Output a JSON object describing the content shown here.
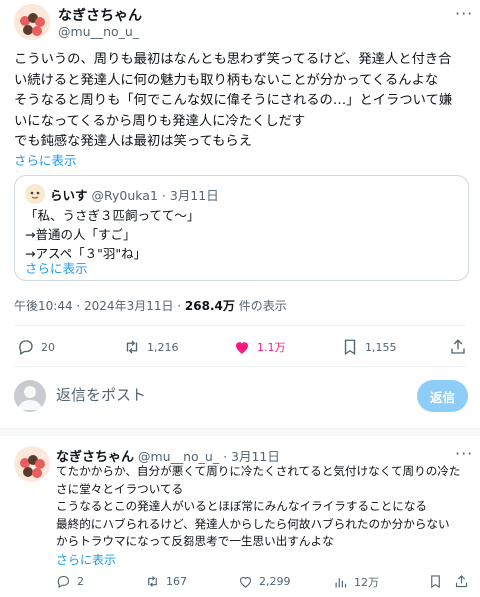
{
  "tweet": {
    "author_name": "なぎさちゃん",
    "author_handle": "@mu__no_u_",
    "lines": [
      "こういうの、周りも最初はなんとも思わず笑ってるけど、発達人と付き合",
      "い続けると発達人に何の魅力も取り柄もないことが分かってくるんよな",
      "そうなると周りも「何でこんな奴に偉そうにされるの…」とイラついて嫌",
      "いになってくるから周りも発達人に冷たくしだす",
      "でも鈍感な発達人は最初は笑ってもらえ"
    ],
    "show_more": "さらに表示",
    "timestamp": "午後10:44 · 2024年3月11日 · ",
    "views_count": "268.4万",
    "views_label": " 件の表示",
    "replies": "20",
    "retweets": "1,216",
    "likes": "1.1万",
    "bookmarks": "1,155"
  },
  "quote": {
    "author_name": "らいす",
    "author_handle": "@Ry0uka1",
    "date": "· 3月11日",
    "lines": [
      "「私、うさぎ３匹飼ってて〜」",
      "→普通の人「すご」",
      "→アスペ「３\"羽\"ね」"
    ],
    "show_more": "さらに表示"
  },
  "composer": {
    "placeholder": "返信をポスト",
    "button": "返信"
  },
  "reply": {
    "author_name": "なぎさちゃん",
    "author_handle": "@mu__no_u_",
    "date": "· 3月11日",
    "lines": [
      "てたかからか、自分が悪くて周りに冷たくされてると気付けなくて周りの冷た",
      "さに堂々とイラついてる",
      "こうなるとこの発達人がいるとほぼ常にみんなイライラすることになる",
      "最終的にハブられるけど、発達人からしたら何故ハブられたのか分からない",
      "からトラウマになって反芻思考で一生思い出すんよな"
    ],
    "show_more": "さらに表示",
    "replies": "2",
    "retweets": "167",
    "likes": "2,299",
    "views": "12万"
  },
  "colors": {
    "accent": "#1d9bf0",
    "like": "#f91880",
    "muted": "#536471"
  }
}
